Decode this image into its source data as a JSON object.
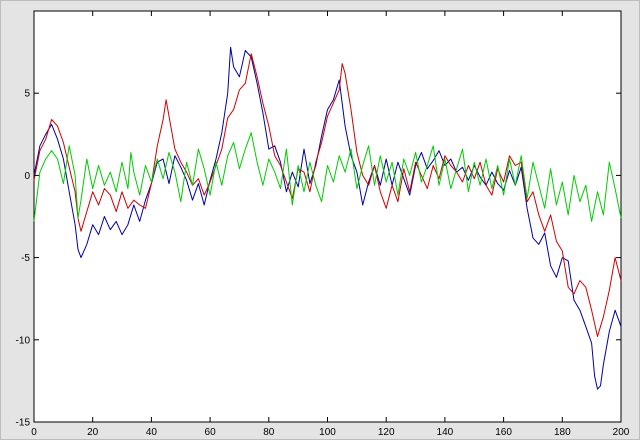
{
  "chart_data": {
    "type": "line",
    "title": "",
    "xlabel": "",
    "ylabel": "",
    "xlim": [
      0,
      200
    ],
    "ylim": [
      -15,
      10
    ],
    "x_ticks": [
      0,
      20,
      40,
      60,
      80,
      100,
      120,
      140,
      160,
      180,
      200
    ],
    "y_ticks": [
      -15,
      -10,
      -5,
      0,
      5
    ],
    "x_tick_labels": [
      "0",
      "20",
      "40",
      "60",
      "80",
      "100",
      "120",
      "140",
      "160",
      "180",
      "200"
    ],
    "y_tick_labels": [
      "-15",
      "-10",
      "-5",
      "0",
      "5"
    ],
    "grid": false,
    "legend": "none",
    "series": [
      {
        "color": "#0000a8",
        "points": [
          [
            0,
            0
          ],
          [
            2,
            1.8
          ],
          [
            4,
            2.5
          ],
          [
            6,
            3.1
          ],
          [
            8,
            2.2
          ],
          [
            10,
            1.0
          ],
          [
            12,
            -1.0
          ],
          [
            14,
            -3.0
          ],
          [
            15,
            -4.5
          ],
          [
            16,
            -5.0
          ],
          [
            18,
            -4.2
          ],
          [
            20,
            -3.0
          ],
          [
            22,
            -3.6
          ],
          [
            24,
            -2.5
          ],
          [
            26,
            -3.3
          ],
          [
            28,
            -2.8
          ],
          [
            30,
            -3.6
          ],
          [
            32,
            -3.0
          ],
          [
            34,
            -1.8
          ],
          [
            36,
            -2.8
          ],
          [
            38,
            -1.5
          ],
          [
            40,
            -0.5
          ],
          [
            42,
            0.8
          ],
          [
            44,
            1.0
          ],
          [
            46,
            -0.5
          ],
          [
            48,
            1.2
          ],
          [
            50,
            0.5
          ],
          [
            52,
            -0.3
          ],
          [
            54,
            -1.5
          ],
          [
            56,
            -0.5
          ],
          [
            58,
            -1.8
          ],
          [
            60,
            -0.3
          ],
          [
            62,
            1.0
          ],
          [
            64,
            2.6
          ],
          [
            66,
            5.0
          ],
          [
            67,
            7.8
          ],
          [
            68,
            6.6
          ],
          [
            70,
            6.0
          ],
          [
            72,
            7.6
          ],
          [
            74,
            7.2
          ],
          [
            76,
            5.6
          ],
          [
            78,
            3.8
          ],
          [
            80,
            1.6
          ],
          [
            82,
            1.8
          ],
          [
            84,
            0.8
          ],
          [
            86,
            -1.0
          ],
          [
            88,
            0.2
          ],
          [
            90,
            -0.7
          ],
          [
            92,
            1.6
          ],
          [
            94,
            -0.5
          ],
          [
            96,
            0.6
          ],
          [
            98,
            2.4
          ],
          [
            100,
            4.0
          ],
          [
            102,
            4.6
          ],
          [
            104,
            5.8
          ],
          [
            106,
            3.0
          ],
          [
            108,
            1.2
          ],
          [
            110,
            0.2
          ],
          [
            112,
            -1.8
          ],
          [
            114,
            -0.4
          ],
          [
            116,
            0.6
          ],
          [
            118,
            -0.6
          ],
          [
            120,
            1.0
          ],
          [
            122,
            -0.6
          ],
          [
            124,
            0.8
          ],
          [
            126,
            -0.2
          ],
          [
            128,
            -1.2
          ],
          [
            130,
            0.6
          ],
          [
            132,
            1.4
          ],
          [
            134,
            0.4
          ],
          [
            136,
            0.9
          ],
          [
            138,
            1.5
          ],
          [
            140,
            0.6
          ],
          [
            142,
            1.0
          ],
          [
            144,
            0.2
          ],
          [
            146,
            0.5
          ],
          [
            148,
            -0.3
          ],
          [
            150,
            0.6
          ],
          [
            152,
            -0.1
          ],
          [
            154,
            -0.6
          ],
          [
            156,
            0.2
          ],
          [
            158,
            -0.5
          ],
          [
            160,
            -0.9
          ],
          [
            162,
            0.3
          ],
          [
            164,
            -0.6
          ],
          [
            166,
            0.5
          ],
          [
            168,
            -2.0
          ],
          [
            170,
            -3.8
          ],
          [
            172,
            -4.2
          ],
          [
            174,
            -3.5
          ],
          [
            176,
            -5.5
          ],
          [
            178,
            -6.2
          ],
          [
            180,
            -5.0
          ],
          [
            182,
            -5.2
          ],
          [
            184,
            -7.6
          ],
          [
            186,
            -8.2
          ],
          [
            188,
            -9.2
          ],
          [
            190,
            -10.2
          ],
          [
            191,
            -12.2
          ],
          [
            192,
            -13.0
          ],
          [
            193,
            -12.8
          ],
          [
            194,
            -11.5
          ],
          [
            196,
            -9.5
          ],
          [
            198,
            -8.2
          ],
          [
            200,
            -9.2
          ]
        ]
      },
      {
        "color": "#d00000",
        "points": [
          [
            0,
            -0.3
          ],
          [
            2,
            1.5
          ],
          [
            4,
            2.2
          ],
          [
            6,
            3.4
          ],
          [
            8,
            3.0
          ],
          [
            10,
            2.0
          ],
          [
            12,
            0.5
          ],
          [
            14,
            -1.0
          ],
          [
            15,
            -2.6
          ],
          [
            16,
            -3.4
          ],
          [
            18,
            -2.2
          ],
          [
            20,
            -1.0
          ],
          [
            22,
            -1.8
          ],
          [
            24,
            -0.8
          ],
          [
            26,
            -1.2
          ],
          [
            28,
            -2.2
          ],
          [
            30,
            -1.0
          ],
          [
            32,
            -2.0
          ],
          [
            34,
            -1.5
          ],
          [
            36,
            -1.8
          ],
          [
            38,
            -2.0
          ],
          [
            40,
            -0.5
          ],
          [
            42,
            1.8
          ],
          [
            44,
            3.4
          ],
          [
            45,
            4.6
          ],
          [
            46,
            3.6
          ],
          [
            48,
            1.6
          ],
          [
            50,
            0.8
          ],
          [
            52,
            0.2
          ],
          [
            54,
            -0.6
          ],
          [
            56,
            -0.2
          ],
          [
            58,
            -1.2
          ],
          [
            60,
            -0.4
          ],
          [
            62,
            0.6
          ],
          [
            64,
            1.6
          ],
          [
            66,
            3.5
          ],
          [
            68,
            4.0
          ],
          [
            70,
            5.2
          ],
          [
            72,
            5.6
          ],
          [
            74,
            7.4
          ],
          [
            76,
            6.0
          ],
          [
            78,
            4.4
          ],
          [
            80,
            3.0
          ],
          [
            82,
            1.2
          ],
          [
            84,
            0.6
          ],
          [
            86,
            -0.4
          ],
          [
            88,
            -1.4
          ],
          [
            90,
            0.4
          ],
          [
            92,
            0.2
          ],
          [
            94,
            -1.0
          ],
          [
            96,
            0.8
          ],
          [
            98,
            2.0
          ],
          [
            100,
            3.6
          ],
          [
            102,
            4.4
          ],
          [
            104,
            5.2
          ],
          [
            105,
            6.8
          ],
          [
            106,
            6.2
          ],
          [
            108,
            4.0
          ],
          [
            110,
            1.4
          ],
          [
            112,
            0.0
          ],
          [
            114,
            -0.6
          ],
          [
            116,
            0.6
          ],
          [
            118,
            -1.0
          ],
          [
            120,
            -2.0
          ],
          [
            122,
            -0.6
          ],
          [
            124,
            -1.6
          ],
          [
            126,
            0.4
          ],
          [
            128,
            -1.0
          ],
          [
            130,
            0.8
          ],
          [
            132,
            0.0
          ],
          [
            134,
            -0.8
          ],
          [
            136,
            0.6
          ],
          [
            138,
            -0.2
          ],
          [
            140,
            1.2
          ],
          [
            142,
            0.6
          ],
          [
            144,
            0.2
          ],
          [
            146,
            -0.4
          ],
          [
            148,
            0.6
          ],
          [
            150,
            -0.2
          ],
          [
            152,
            0.8
          ],
          [
            154,
            -0.6
          ],
          [
            156,
            -1.2
          ],
          [
            158,
            0.4
          ],
          [
            160,
            -0.4
          ],
          [
            162,
            1.2
          ],
          [
            164,
            0.6
          ],
          [
            166,
            0.8
          ],
          [
            168,
            -1.6
          ],
          [
            170,
            -1.0
          ],
          [
            172,
            -2.4
          ],
          [
            174,
            -3.4
          ],
          [
            176,
            -2.4
          ],
          [
            178,
            -4.0
          ],
          [
            180,
            -4.6
          ],
          [
            182,
            -6.8
          ],
          [
            184,
            -7.2
          ],
          [
            186,
            -6.4
          ],
          [
            188,
            -6.8
          ],
          [
            190,
            -8.2
          ],
          [
            192,
            -9.8
          ],
          [
            194,
            -8.6
          ],
          [
            196,
            -7.0
          ],
          [
            198,
            -5.0
          ],
          [
            200,
            -6.4
          ]
        ]
      },
      {
        "color": "#00cc00",
        "points": [
          [
            0,
            -2.8
          ],
          [
            2,
            0.2
          ],
          [
            4,
            1.0
          ],
          [
            6,
            1.5
          ],
          [
            8,
            1.0
          ],
          [
            10,
            -0.5
          ],
          [
            12,
            1.8
          ],
          [
            14,
            0.0
          ],
          [
            15,
            -2.6
          ],
          [
            16,
            -1.5
          ],
          [
            18,
            1.0
          ],
          [
            20,
            -0.8
          ],
          [
            22,
            0.6
          ],
          [
            24,
            -0.6
          ],
          [
            26,
            0.2
          ],
          [
            28,
            -1.0
          ],
          [
            30,
            0.8
          ],
          [
            32,
            -0.8
          ],
          [
            33,
            1.4
          ],
          [
            34,
            0.2
          ],
          [
            36,
            -1.2
          ],
          [
            38,
            0.6
          ],
          [
            40,
            -0.4
          ],
          [
            42,
            1.0
          ],
          [
            44,
            -0.2
          ],
          [
            46,
            1.4
          ],
          [
            48,
            0.2
          ],
          [
            50,
            -1.6
          ],
          [
            52,
            0.8
          ],
          [
            54,
            -0.6
          ],
          [
            56,
            1.6
          ],
          [
            58,
            0.4
          ],
          [
            60,
            -1.2
          ],
          [
            62,
            0.8
          ],
          [
            64,
            -0.6
          ],
          [
            66,
            1.2
          ],
          [
            68,
            2.0
          ],
          [
            70,
            0.4
          ],
          [
            72,
            1.6
          ],
          [
            74,
            2.6
          ],
          [
            76,
            0.8
          ],
          [
            78,
            -0.6
          ],
          [
            80,
            1.0
          ],
          [
            82,
            0.2
          ],
          [
            84,
            -0.8
          ],
          [
            86,
            1.6
          ],
          [
            88,
            -1.8
          ],
          [
            90,
            0.6
          ],
          [
            92,
            -1.0
          ],
          [
            94,
            0.8
          ],
          [
            96,
            -0.6
          ],
          [
            98,
            -1.6
          ],
          [
            100,
            0.6
          ],
          [
            102,
            -0.4
          ],
          [
            104,
            1.2
          ],
          [
            106,
            0.2
          ],
          [
            108,
            1.6
          ],
          [
            110,
            -0.8
          ],
          [
            112,
            0.6
          ],
          [
            114,
            1.8
          ],
          [
            116,
            -0.6
          ],
          [
            118,
            1.2
          ],
          [
            120,
            -0.4
          ],
          [
            122,
            0.8
          ],
          [
            124,
            -1.2
          ],
          [
            126,
            1.0
          ],
          [
            128,
            0.0
          ],
          [
            130,
            1.4
          ],
          [
            132,
            -0.4
          ],
          [
            134,
            0.6
          ],
          [
            136,
            1.8
          ],
          [
            138,
            -0.6
          ],
          [
            140,
            1.0
          ],
          [
            142,
            -0.8
          ],
          [
            144,
            0.4
          ],
          [
            146,
            1.6
          ],
          [
            148,
            -1.0
          ],
          [
            150,
            0.8
          ],
          [
            152,
            -0.6
          ],
          [
            154,
            1.0
          ],
          [
            156,
            -0.8
          ],
          [
            158,
            0.6
          ],
          [
            160,
            -1.2
          ],
          [
            162,
            1.0
          ],
          [
            164,
            -0.6
          ],
          [
            166,
            1.2
          ],
          [
            168,
            -1.4
          ],
          [
            170,
            0.8
          ],
          [
            172,
            -0.6
          ],
          [
            174,
            -2.0
          ],
          [
            176,
            0.4
          ],
          [
            178,
            -1.8
          ],
          [
            180,
            -0.4
          ],
          [
            182,
            -2.4
          ],
          [
            184,
            0.0
          ],
          [
            186,
            -1.6
          ],
          [
            188,
            -0.6
          ],
          [
            190,
            -2.8
          ],
          [
            192,
            -1.0
          ],
          [
            194,
            -2.4
          ],
          [
            196,
            0.8
          ],
          [
            198,
            -0.8
          ],
          [
            200,
            -2.6
          ]
        ]
      }
    ]
  }
}
